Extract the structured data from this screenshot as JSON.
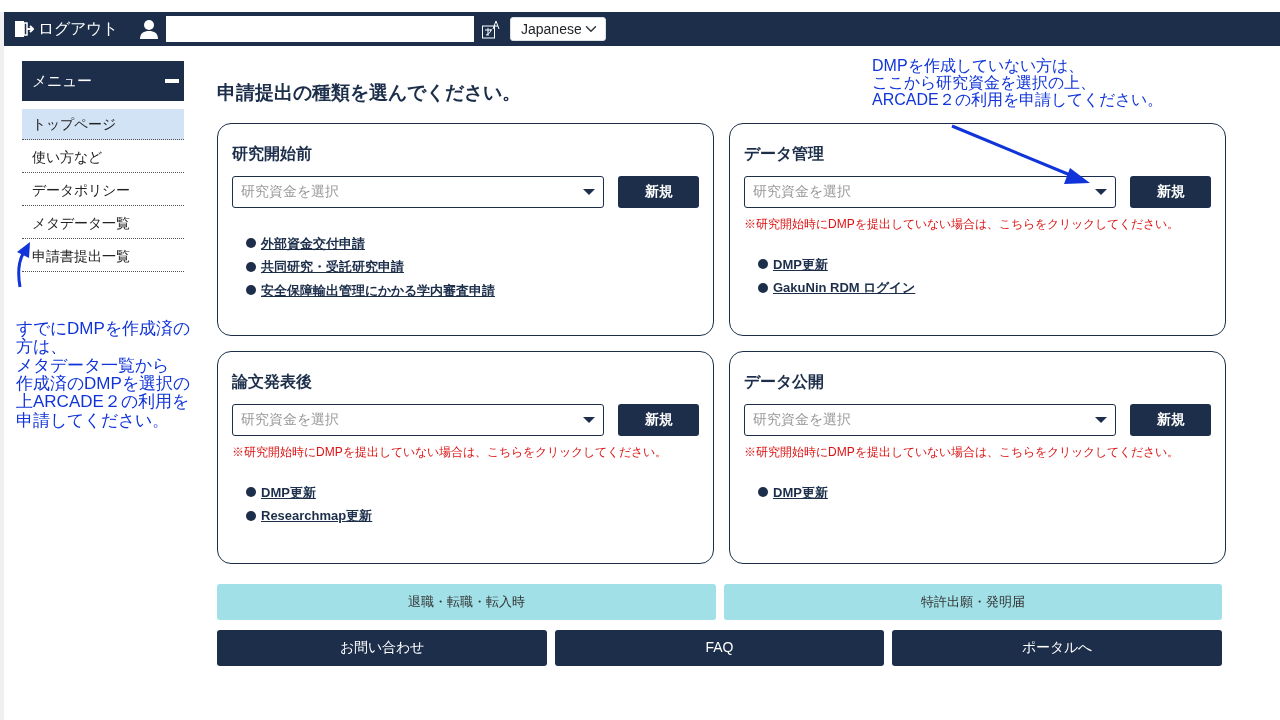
{
  "top_bar": {
    "logout": "ログアウト",
    "language": "Japanese"
  },
  "menu": {
    "title": "メニュー",
    "expanded": true,
    "items": [
      {
        "label": "トップページ",
        "selected": true
      },
      {
        "label": "使い方など",
        "selected": false
      },
      {
        "label": "データポリシー",
        "selected": false
      },
      {
        "label": "メタデータ一覧",
        "selected": false
      },
      {
        "label": "申請書提出一覧",
        "selected": false
      }
    ]
  },
  "heading": "申請提出の種類を選んでください。",
  "annotations": [
    {
      "lines": [
        "DMPを作成していない方は、",
        "ここから研究資金を選択の上、",
        "ARCADE２の利用を申請してください。"
      ]
    },
    {
      "lines": [
        "すでにDMPを作成済の方は、",
        "メタデータ一覧から",
        "作成済のDMPを選択の上ARCADE２の利用を申請してください。"
      ]
    }
  ],
  "cards": [
    {
      "title": "研究開始前",
      "placeholder": "研究資金を選択",
      "button": "新規",
      "links": [
        "外部資金交付申請",
        "共同研究・受託研究申請",
        "安全保障輸出管理にかかる学内審査申請"
      ]
    },
    {
      "title": "データ管理",
      "placeholder": "研究資金を選択",
      "button": "新規",
      "notice": "※研究開始時にDMPを提出していない場合は、こちらをクリックしてください。",
      "links": [
        "DMP更新",
        "GakuNin RDM ログイン"
      ]
    },
    {
      "title": "論文発表後",
      "placeholder": "研究資金を選択",
      "button": "新規",
      "notice": "※研究開始時にDMPを提出していない場合は、こちらをクリックしてください。",
      "links": [
        "DMP更新",
        "Researchmap更新"
      ]
    },
    {
      "title": "データ公開",
      "placeholder": "研究資金を選択",
      "button": "新規",
      "notice": "※研究開始時にDMPを提出していない場合は、こちらをクリックしてください。",
      "links": [
        "DMP更新"
      ]
    }
  ],
  "secondary_buttons": [
    "退職・転職・転入時",
    "特許出願・発明届"
  ],
  "primary_buttons": [
    "お問い合わせ",
    "FAQ",
    "ポータルへ"
  ]
}
